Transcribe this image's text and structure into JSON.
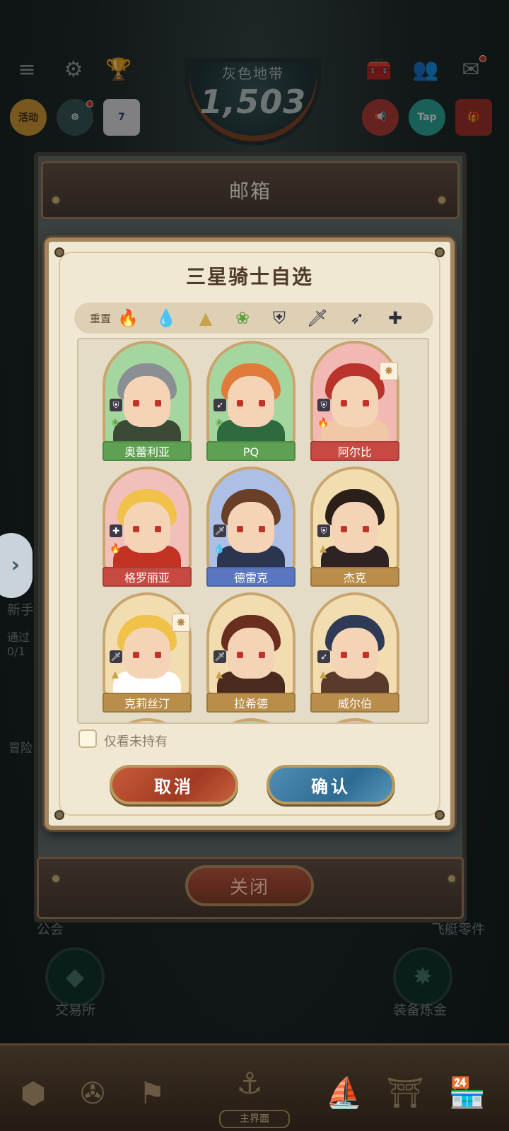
{
  "top": {
    "zone_name": "灰色地带",
    "score": "1,503",
    "activity_label": "活动",
    "tap_label": "Tap",
    "calendar_day": "7"
  },
  "mailbox": {
    "title": "邮箱",
    "close_label": "关闭"
  },
  "dialog": {
    "title": "三星骑士自选",
    "reset_label": "重置",
    "filters": [
      {
        "name": "fire-filter-icon",
        "glyph": "🔥",
        "color": "#c2332a"
      },
      {
        "name": "water-filter-icon",
        "glyph": "💧",
        "color": "#2f6fd0"
      },
      {
        "name": "earth-filter-icon",
        "glyph": "▲",
        "color": "#c9a24a"
      },
      {
        "name": "wind-filter-icon",
        "glyph": "❀",
        "color": "#5aa13a"
      },
      {
        "name": "tank-class-filter-icon",
        "glyph": "⛨",
        "color": "#2e2f3d"
      },
      {
        "name": "warrior-class-filter-icon",
        "glyph": "🗡",
        "color": "#2e2f3d"
      },
      {
        "name": "ranger-class-filter-icon",
        "glyph": "➶",
        "color": "#2e2f3d"
      },
      {
        "name": "support-class-filter-icon",
        "glyph": "✚",
        "color": "#2e2f3d"
      }
    ],
    "knights": [
      {
        "name": "奥蕾利亚",
        "bg": "#a6d6a0",
        "label_bg": "#5fa152",
        "hair": "#8a8f93",
        "body": "#3b4a36",
        "elem": "❀",
        "elem_color": "#5aa13a",
        "cls": "⛨",
        "star": false
      },
      {
        "name": "PQ",
        "bg": "#a6d6a0",
        "label_bg": "#5fa152",
        "hair": "#e07b3a",
        "body": "#2d6a3e",
        "elem": "❀",
        "elem_color": "#5aa13a",
        "cls": "➶",
        "star": false
      },
      {
        "name": "阿尔比",
        "bg": "#f2b8b3",
        "label_bg": "#c64a42",
        "hair": "#b8332b",
        "body": "#f0c8a8",
        "elem": "🔥",
        "elem_color": "#c2332a",
        "cls": "⛨",
        "star": true
      },
      {
        "name": "格罗丽亚",
        "bg": "#f2c0bb",
        "label_bg": "#c64a42",
        "hair": "#f0c24a",
        "body": "#c23326",
        "elem": "🔥",
        "elem_color": "#c2332a",
        "cls": "✚",
        "star": false
      },
      {
        "name": "德雷克",
        "bg": "#aebfe6",
        "label_bg": "#5b76c0",
        "hair": "#6a3f28",
        "body": "#2b3550",
        "elem": "💧",
        "elem_color": "#2f6fd0",
        "cls": "🗡",
        "star": false
      },
      {
        "name": "杰克",
        "bg": "#f2ddb0",
        "label_bg": "#b98d4a",
        "hair": "#2b1f1a",
        "body": "#2e2225",
        "elem": "▲",
        "elem_color": "#c9a24a",
        "cls": "⛨",
        "star": false
      },
      {
        "name": "克莉丝汀",
        "bg": "#f2ddb0",
        "label_bg": "#b98d4a",
        "hair": "#f0c24a",
        "body": "#ffffff",
        "elem": "▲",
        "elem_color": "#c9a24a",
        "cls": "🗡",
        "star": true
      },
      {
        "name": "拉希德",
        "bg": "#f2ddb0",
        "label_bg": "#b98d4a",
        "hair": "#6a2e1e",
        "body": "#4a2a1e",
        "elem": "▲",
        "elem_color": "#c9a24a",
        "cls": "🗡",
        "star": false
      },
      {
        "name": "威尔伯",
        "bg": "#f2ddb0",
        "label_bg": "#b98d4a",
        "hair": "#2e3a56",
        "body": "#5a3a2a",
        "elem": "▲",
        "elem_color": "#c9a24a",
        "cls": "➶",
        "star": false
      }
    ],
    "only_unowned_label": "仅看未持有",
    "cancel_label": "取消",
    "confirm_label": "确认"
  },
  "background_labels": {
    "newbie": "新手",
    "pass": "通过",
    "progress": "0/1",
    "adventure": "冒险日",
    "guild": "公会",
    "exchange": "交易所",
    "equipment_alchemy": "装备炼金",
    "parts": "飞艇零件",
    "home": "主界面"
  }
}
